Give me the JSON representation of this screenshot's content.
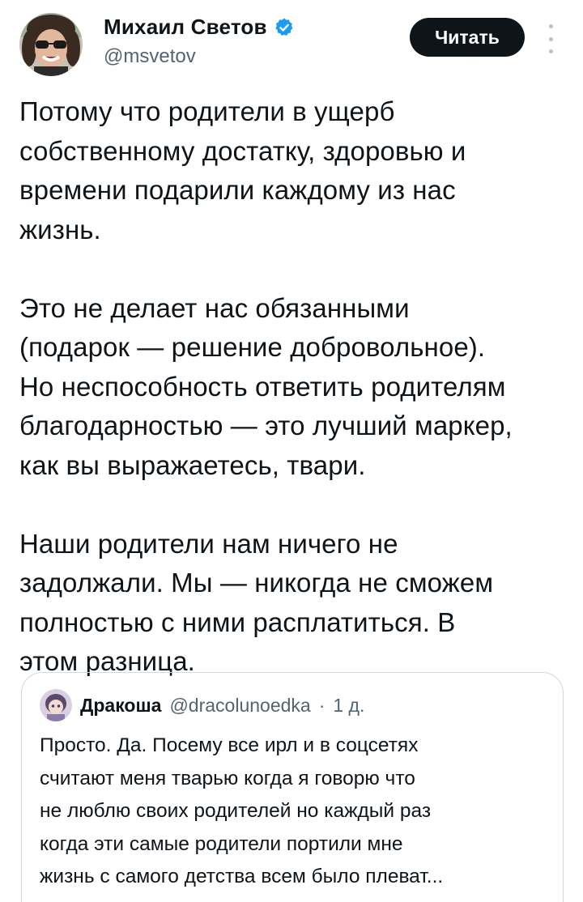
{
  "tweet": {
    "author": {
      "name": "Михаил Светов",
      "handle": "@msvetov",
      "verified": true,
      "avatar_icon": "author-avatar-photo"
    },
    "follow_label": "Читать",
    "more_icon": "more-options-icon",
    "paragraphs": [
      [
        "Потому что родители в ущерб",
        "собственному достатку, здоровью и",
        "времени подарили каждому из нас",
        "жизнь."
      ],
      [
        "Это не делает нас обязанными",
        "(подарок — решение добровольное).",
        "Но неспособность ответить родителям",
        "благодарностью — это лучший маркер,",
        "как вы выражаетесь, твари."
      ],
      [
        "Наши родители нам ничего не",
        "задолжали. Мы — никогда не сможем",
        "полностью с ними расплатиться. В",
        "этом разница."
      ]
    ]
  },
  "quote": {
    "name": "Дракоша",
    "handle": "@dracolunoedka",
    "separator": "·",
    "time": "1 д.",
    "lines": [
      "Просто. Да. Посему все ирл и в соцсетях",
      "считают меня тварью когда я говорю что",
      "не люблю своих родителей но каждый раз",
      "когда эти самые родители портили мне",
      "жизнь с самого детства всем было плеват..."
    ]
  },
  "colors": {
    "text": "#0f1419",
    "secondary": "#536471",
    "verified_blue": "#1d9bf0",
    "button_bg": "#0f1419",
    "border": "#cfd9de"
  }
}
